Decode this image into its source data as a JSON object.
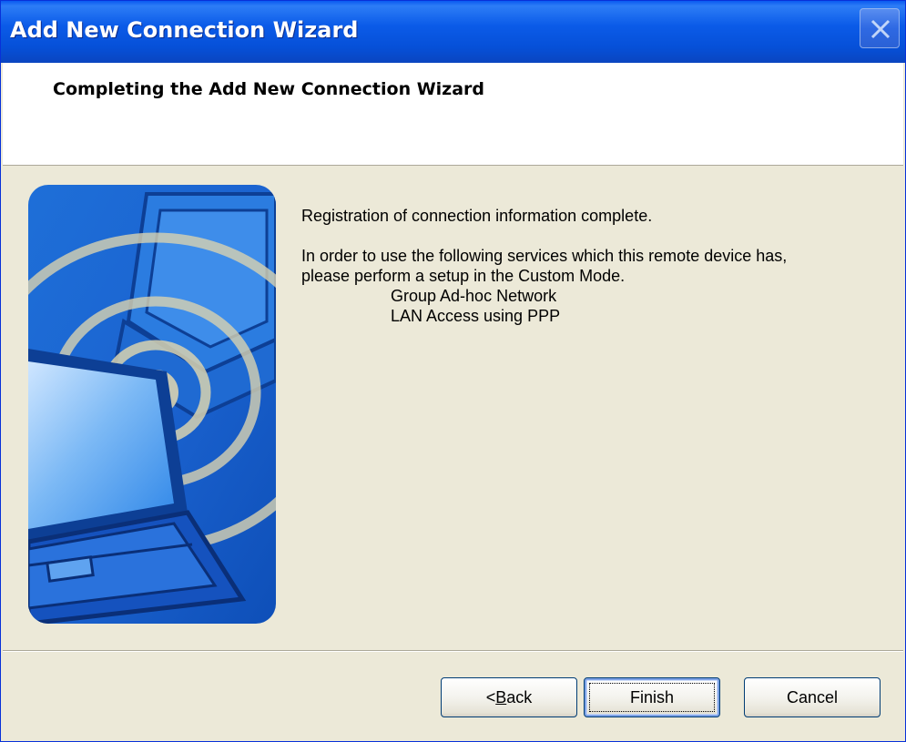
{
  "window": {
    "title": "Add New Connection Wizard"
  },
  "header": {
    "title": "Completing the Add New Connection Wizard"
  },
  "content": {
    "line1": "Registration of connection information complete.",
    "line2": "In order to use the following services which this remote device has,",
    "line3": "please perform a setup in the Custom Mode.",
    "services": [
      "Group Ad-hoc Network",
      "LAN Access using PPP"
    ]
  },
  "buttons": {
    "back_prefix": "< ",
    "back_mnemonic": "B",
    "back_rest": "ack",
    "finish": "Finish",
    "cancel": "Cancel"
  },
  "icons": {
    "close": "close-icon",
    "graphic": "wireless-laptop-illustration"
  },
  "colors": {
    "titlebar": "#0A5AF0",
    "dialog_bg": "#ECE9D8",
    "graphic_blue": "#1E72E6"
  }
}
